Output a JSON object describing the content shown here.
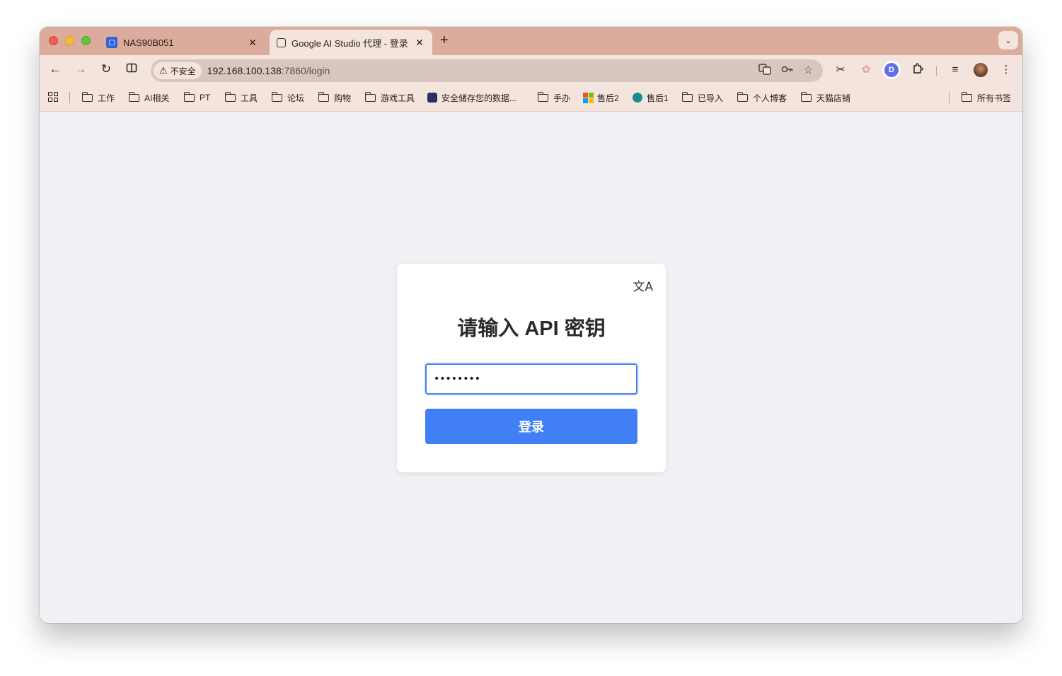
{
  "tabs": [
    {
      "title": "NAS90B051",
      "close": "✕"
    },
    {
      "title": "Google AI Studio 代理 - 登录",
      "close": "✕"
    }
  ],
  "tabstrip": {
    "new_tab": "+",
    "search_tabs": "⌄"
  },
  "toolbar": {
    "back": "←",
    "forward": "→",
    "reload": "↻",
    "security_label": "不安全",
    "url_host": "192.168.100.138",
    "url_path": ":7860/login"
  },
  "bookmarks": [
    {
      "label": "工作",
      "icon": "folder-icon"
    },
    {
      "label": "AI相关",
      "icon": "folder-icon"
    },
    {
      "label": "PT",
      "icon": "folder-icon"
    },
    {
      "label": "工具",
      "icon": "folder-icon"
    },
    {
      "label": "论坛",
      "icon": "folder-icon"
    },
    {
      "label": "购物",
      "icon": "folder-icon"
    },
    {
      "label": "游戏工具",
      "icon": "folder-icon"
    },
    {
      "label": "安全储存您的数据...",
      "icon": "shield-favicon"
    },
    {
      "label": "手办",
      "icon": "folder-icon"
    },
    {
      "label": "售后2",
      "icon": "microsoft-favicon"
    },
    {
      "label": "售后1",
      "icon": "sharepoint-favicon"
    },
    {
      "label": "已导入",
      "icon": "folder-icon"
    },
    {
      "label": "个人博客",
      "icon": "folder-icon"
    },
    {
      "label": "天猫店铺",
      "icon": "folder-icon"
    },
    {
      "label": "所有书签",
      "icon": "folder-icon"
    }
  ],
  "login": {
    "title": "请输入 API 密钥",
    "key_value": "12345678",
    "button_label": "登录",
    "language_icon": "文A"
  },
  "colors": {
    "tabstrip": "#dbab9b",
    "toolbar": "#f3e4dd",
    "page_background": "#f0f1f5",
    "button": "#417ff6"
  }
}
